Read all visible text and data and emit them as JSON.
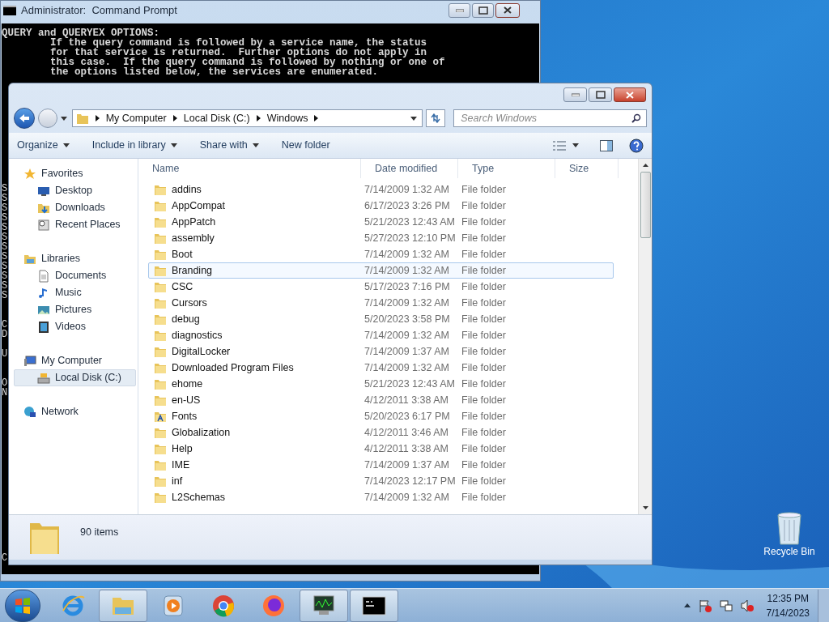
{
  "cmd": {
    "title": "Administrator:  Command Prompt",
    "lines": [
      "QUERY and QUERYEX OPTIONS:",
      "        If the query command is followed by a service name, the status",
      "        for that service is returned.  Further options do not apply in",
      "        this case.  If the query command is followed by nothing or one of",
      "        the options listed below, the services are enumerated."
    ],
    "side_fragments": "S\nS\nS\nS\nS\nS\nS\nS\nS\nS\nS\nS\n\n\nC\nD\n\nU\n\n\nO\nN\n\n\n\n\n\n\n\n\n\n\n\n\n\n\n\n\nC"
  },
  "explorer": {
    "breadcrumb": [
      "My Computer",
      "Local Disk (C:)",
      "Windows"
    ],
    "search": {
      "placeholder": "Search Windows"
    },
    "toolbar": [
      {
        "label": "Organize",
        "dropdown": true
      },
      {
        "label": "Include in library",
        "dropdown": true
      },
      {
        "label": "Share with",
        "dropdown": true
      },
      {
        "label": "New folder",
        "dropdown": false
      }
    ],
    "nav": [
      {
        "label": "Favorites",
        "selected": false,
        "children": [
          {
            "label": "Desktop",
            "selected": false
          },
          {
            "label": "Downloads",
            "selected": false
          },
          {
            "label": "Recent Places",
            "selected": false
          }
        ]
      },
      {
        "label": "Libraries",
        "selected": false,
        "children": [
          {
            "label": "Documents",
            "selected": false
          },
          {
            "label": "Music",
            "selected": false
          },
          {
            "label": "Pictures",
            "selected": false
          },
          {
            "label": "Videos",
            "selected": false
          }
        ]
      },
      {
        "label": "My Computer",
        "selected": false,
        "children": [
          {
            "label": "Local Disk (C:)",
            "selected": true
          }
        ]
      },
      {
        "label": "Network",
        "selected": false
      }
    ],
    "columns": [
      "Name",
      "Date modified",
      "Type",
      "Size"
    ],
    "rows": [
      {
        "name": "addins",
        "date": "7/14/2009 1:32 AM",
        "type": "File folder",
        "selected": false,
        "kind": "folder"
      },
      {
        "name": "AppCompat",
        "date": "6/17/2023 3:26 PM",
        "type": "File folder",
        "selected": false,
        "kind": "folder"
      },
      {
        "name": "AppPatch",
        "date": "5/21/2023 12:43 AM",
        "type": "File folder",
        "selected": false,
        "kind": "folder"
      },
      {
        "name": "assembly",
        "date": "5/27/2023 12:10 PM",
        "type": "File folder",
        "selected": false,
        "kind": "folder"
      },
      {
        "name": "Boot",
        "date": "7/14/2009 1:32 AM",
        "type": "File folder",
        "selected": false,
        "kind": "folder"
      },
      {
        "name": "Branding",
        "date": "7/14/2009 1:32 AM",
        "type": "File folder",
        "selected": true,
        "kind": "folder"
      },
      {
        "name": "CSC",
        "date": "5/17/2023 7:16 PM",
        "type": "File folder",
        "selected": false,
        "kind": "folder"
      },
      {
        "name": "Cursors",
        "date": "7/14/2009 1:32 AM",
        "type": "File folder",
        "selected": false,
        "kind": "folder"
      },
      {
        "name": "debug",
        "date": "5/20/2023 3:58 PM",
        "type": "File folder",
        "selected": false,
        "kind": "folder"
      },
      {
        "name": "diagnostics",
        "date": "7/14/2009 1:32 AM",
        "type": "File folder",
        "selected": false,
        "kind": "folder"
      },
      {
        "name": "DigitalLocker",
        "date": "7/14/2009 1:37 AM",
        "type": "File folder",
        "selected": false,
        "kind": "folder"
      },
      {
        "name": "Downloaded Program Files",
        "date": "7/14/2009 1:32 AM",
        "type": "File folder",
        "selected": false,
        "kind": "folder"
      },
      {
        "name": "ehome",
        "date": "5/21/2023 12:43 AM",
        "type": "File folder",
        "selected": false,
        "kind": "folder"
      },
      {
        "name": "en-US",
        "date": "4/12/2011 3:38 AM",
        "type": "File folder",
        "selected": false,
        "kind": "folder"
      },
      {
        "name": "Fonts",
        "date": "5/20/2023 6:17 PM",
        "type": "File folder",
        "selected": false,
        "kind": "fonts"
      },
      {
        "name": "Globalization",
        "date": "4/12/2011 3:46 AM",
        "type": "File folder",
        "selected": false,
        "kind": "folder"
      },
      {
        "name": "Help",
        "date": "4/12/2011 3:38 AM",
        "type": "File folder",
        "selected": false,
        "kind": "folder"
      },
      {
        "name": "IME",
        "date": "7/14/2009 1:37 AM",
        "type": "File folder",
        "selected": false,
        "kind": "folder"
      },
      {
        "name": "inf",
        "date": "7/14/2023 12:17 PM",
        "type": "File folder",
        "selected": false,
        "kind": "folder"
      },
      {
        "name": "L2Schemas",
        "date": "7/14/2009 1:32 AM",
        "type": "File folder",
        "selected": false,
        "kind": "folder"
      }
    ],
    "status": "90 items"
  },
  "desktop_icons": [
    {
      "label": "Recycle Bin"
    }
  ],
  "taskbar": {
    "apps": [
      {
        "kind": "ie",
        "active": false
      },
      {
        "kind": "explorer",
        "active": true
      },
      {
        "kind": "media",
        "active": false
      },
      {
        "kind": "chrome",
        "active": false
      },
      {
        "kind": "firefox",
        "active": false
      },
      {
        "kind": "monitor",
        "active": true
      },
      {
        "kind": "cmd",
        "active": true
      }
    ],
    "time": "12:35 PM",
    "date": "7/14/2023"
  }
}
